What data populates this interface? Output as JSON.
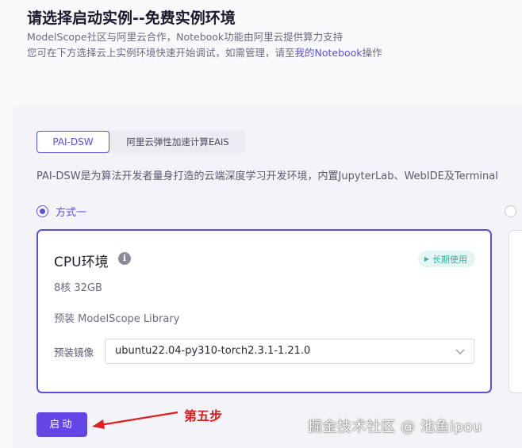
{
  "header": {
    "title": "请选择启动实例--免费实例环境",
    "subtitle_line1": "ModelScope社区与阿里云合作，Notebook功能由阿里云提供算力支持",
    "subtitle_line2_prefix": "您可在下方选择云上实例环境快速开始调试，如需管理，请至",
    "subtitle_line2_link": "我的Notebook",
    "subtitle_line2_suffix": "操作"
  },
  "tabs": [
    {
      "label": "PAI-DSW",
      "active": true
    },
    {
      "label": "阿里云弹性加速计算EAIS",
      "active": false
    }
  ],
  "description": "PAI-DSW是为算法开发者量身打造的云端深度学习开发环境，内置JupyterLab、WebIDE及Terminal",
  "option": {
    "label": "方式一",
    "selected": true
  },
  "card": {
    "title": "CPU环境",
    "badge": "长期使用",
    "spec": "8核 32GB",
    "preinstall": "预装 ModelScope Library",
    "image_label": "预装镜像",
    "image_value": "ubuntu22.04-py310-torch2.3.1-1.21.0"
  },
  "actions": {
    "start_label": "启动"
  },
  "annotation": {
    "step_label": "第五步"
  },
  "watermark": "掘金技术社区 @ 池鱼ipou",
  "colors": {
    "accent": "#5b4fe0",
    "button": "#6446e6",
    "badge_text": "#2fb3a2",
    "badge_bg": "#e3f6f3",
    "annotation": "#e02020"
  },
  "icons": {
    "info": "info-icon",
    "badge": "play-icon",
    "select": "chevron-down-icon",
    "arrow": "arrow-left-icon"
  }
}
